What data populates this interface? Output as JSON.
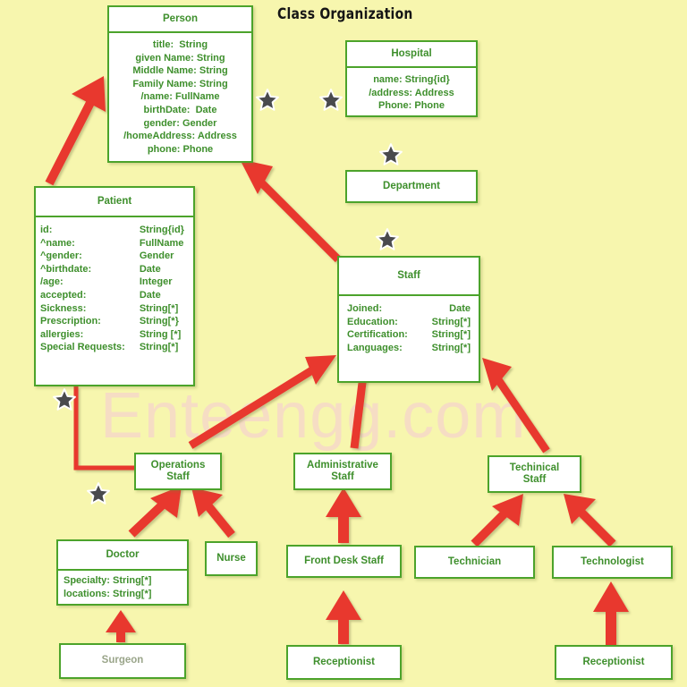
{
  "diagram": {
    "title": "Class Organization",
    "watermark": "Enteengg.com",
    "background_color": "#f7f6ae",
    "box_border_color": "#4ca32b",
    "text_color": "#3e8f2c",
    "connector_color": "#e8392e",
    "watermark_color": "#f6ddc4"
  },
  "classes": {
    "person": {
      "name": "Person",
      "attributes": [
        {
          "key": "title:",
          "value": "String"
        },
        {
          "key": "given Name:",
          "value": "String"
        },
        {
          "key": "Middle Name:",
          "value": "String"
        },
        {
          "key": "Family Name:",
          "value": "String"
        },
        {
          "key": "/name:",
          "value": "FullName"
        },
        {
          "key": "birthDate:",
          "value": "Date"
        },
        {
          "key": "gender:",
          "value": "Gender"
        },
        {
          "key": "/homeAddress:",
          "value": "Address"
        },
        {
          "key": "phone:",
          "value": "Phone"
        }
      ]
    },
    "hospital": {
      "name": "Hospital",
      "attributes": [
        {
          "key": "name:",
          "value": "String{id}"
        },
        {
          "key": "/address:",
          "value": "Address"
        },
        {
          "key": "Phone:",
          "value": "Phone"
        }
      ]
    },
    "department": {
      "name": "Department",
      "attributes": []
    },
    "patient": {
      "name": "Patient",
      "attributes": [
        {
          "key": "id:",
          "value": "String{id}"
        },
        {
          "key": "^name:",
          "value": "FullName"
        },
        {
          "key": "^gender:",
          "value": "Gender"
        },
        {
          "key": "^birthdate:",
          "value": "Date"
        },
        {
          "key": "/age:",
          "value": "Integer"
        },
        {
          "key": "accepted:",
          "value": "Date"
        },
        {
          "key": "Sickness:",
          "value": "String[*]"
        },
        {
          "key": "Prescription:",
          "value": "String[*}"
        },
        {
          "key": "allergies:",
          "value": "String [*]"
        },
        {
          "key": "Special Requests:",
          "value": "String[*]"
        }
      ]
    },
    "staff": {
      "name": "Staff",
      "attributes": [
        {
          "key": "Joined:",
          "value": "Date"
        },
        {
          "key": "Education:",
          "value": "String[*]"
        },
        {
          "key": "Certification:",
          "value": "String[*]"
        },
        {
          "key": "Languages:",
          "value": "String[*]"
        }
      ]
    },
    "operations_staff": {
      "name": "Operations\nStaff",
      "line1": "Operations",
      "line2": "Staff"
    },
    "administrative_staff": {
      "name": "Administrative\nStaff",
      "line1": "Administrative",
      "line2": "Staff"
    },
    "technical_staff": {
      "name": "Techinical\nStaff",
      "line1": "Techinical",
      "line2": "Staff"
    },
    "doctor": {
      "name": "Doctor",
      "attributes": [
        {
          "key": "Specialty:",
          "value": "String[*]"
        },
        {
          "key": "locations:",
          "value": "String[*]"
        }
      ]
    },
    "nurse": {
      "name": "Nurse"
    },
    "surgeon": {
      "name": "Surgeon"
    },
    "front_desk_staff": {
      "name": "Front Desk Staff"
    },
    "receptionist_admin": {
      "name": "Receptionist"
    },
    "technician": {
      "name": "Technician"
    },
    "technologist": {
      "name": "Technologist"
    },
    "receptionist_tech": {
      "name": "Receptionist"
    }
  }
}
